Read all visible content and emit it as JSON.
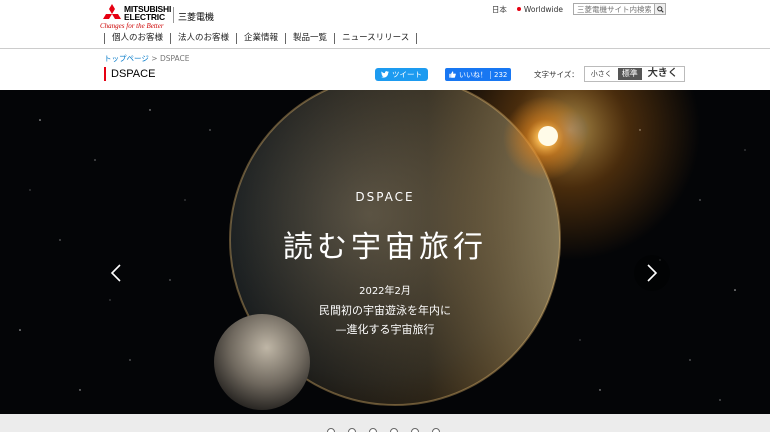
{
  "header": {
    "brand_line1": "MITSUBISHI",
    "brand_line2": "ELECTRIC",
    "tagline": "Changes for the Better",
    "brand_jp": "三菱電機",
    "lang": "日本",
    "worldwide": "Worldwide",
    "search_placeholder": "三菱電機サイト内検索",
    "nav": [
      "個人のお客様",
      "法人のお客様",
      "企業情報",
      "製品一覧",
      "ニュースリリース"
    ]
  },
  "subheader": {
    "breadcrumb_home": "トップページ",
    "breadcrumb_sep": ">",
    "breadcrumb_current": "DSPACE",
    "page_title": "DSPACE",
    "tweet_label": "ツイート",
    "like_label": "いいね！",
    "like_count": "232",
    "fontsize_label": "文字サイズ：",
    "fontsize_small": "小さく",
    "fontsize_standard": "標準",
    "fontsize_large": "大きく"
  },
  "hero": {
    "eyebrow": "DSPACE",
    "title": "読む宇宙旅行",
    "date": "2022年2月",
    "line1": "民間初の宇宙遊泳を年内に",
    "line2": "—進化する宇宙旅行"
  },
  "colors": {
    "accent_red": "#e60012",
    "link_blue": "#0078c8",
    "twitter_blue": "#1d9bf0",
    "facebook_blue": "#1877f2"
  }
}
